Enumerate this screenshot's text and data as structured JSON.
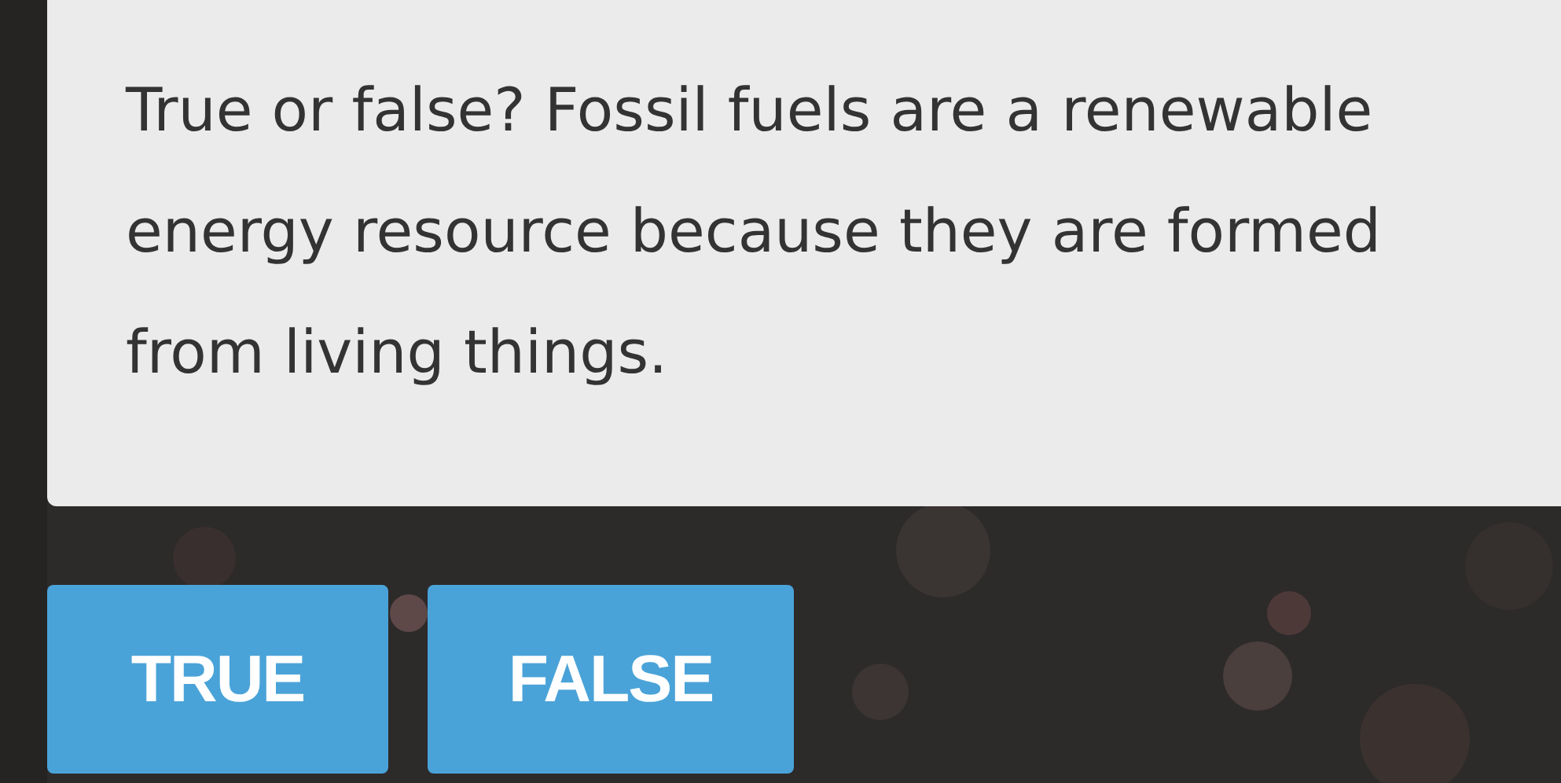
{
  "question": "True or false? Fossil fuels are a renewable energy resource because they are formed from living things.",
  "answers": [
    {
      "label": "TRUE"
    },
    {
      "label": "FALSE"
    }
  ]
}
